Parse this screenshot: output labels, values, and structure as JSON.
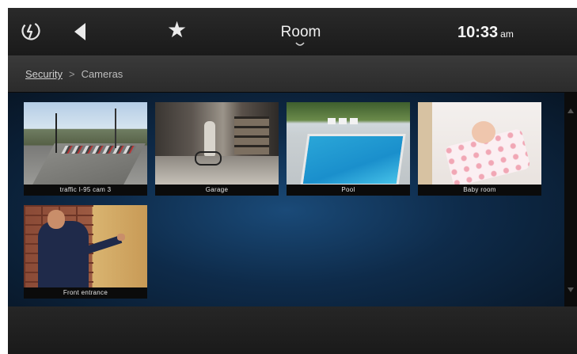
{
  "topbar": {
    "logo_icon": "power-swirl-logo-icon",
    "back_icon": "back-triangle-icon",
    "favorite_icon": "star-icon",
    "favorite_glyph": "★",
    "room_title": "Room",
    "room_chevron_icon": "chevron-down-icon",
    "time": "10:33",
    "time_suffix": "am"
  },
  "breadcrumb": {
    "root": "Security",
    "separator": ">",
    "current": "Cameras"
  },
  "cameras": [
    {
      "label": "traffic I-95 cam 3",
      "thumb_icon": "traffic-camera-thumbnail"
    },
    {
      "label": "Garage",
      "thumb_icon": "garage-camera-thumbnail"
    },
    {
      "label": "Pool",
      "thumb_icon": "pool-camera-thumbnail"
    },
    {
      "label": "Baby room",
      "thumb_icon": "baby-room-camera-thumbnail"
    },
    {
      "label": "Front entrance",
      "thumb_icon": "front-entrance-camera-thumbnail"
    }
  ],
  "scrollbar": {
    "up_icon": "scroll-up-arrow-icon",
    "down_icon": "scroll-down-arrow-icon"
  },
  "colors": {
    "background": "#141414",
    "content_glow": "#1a4a78",
    "text": "#f2f2f2"
  }
}
